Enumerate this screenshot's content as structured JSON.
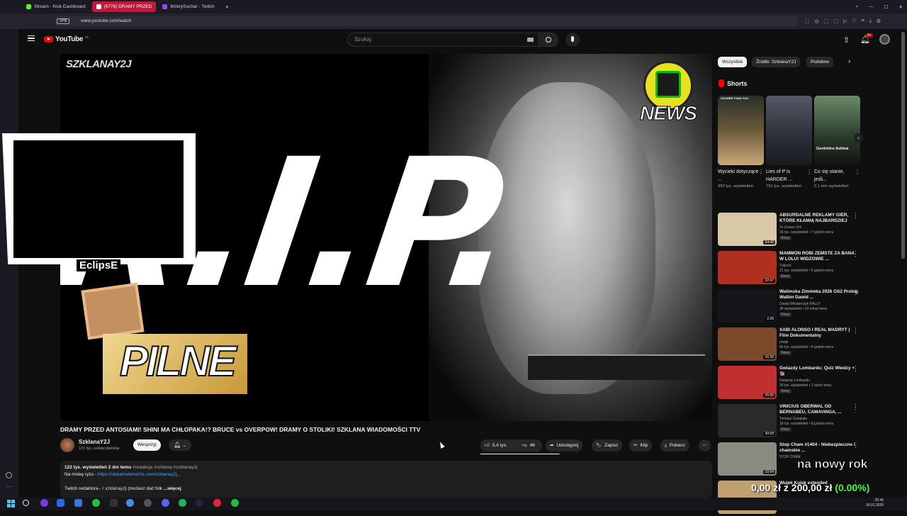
{
  "browser": {
    "tabs": [
      {
        "label": "Stream - Kick Dashboard",
        "color": "#53fc18"
      },
      {
        "label": "(6778) DRAMY PRZED",
        "color": "#ff0000"
      },
      {
        "label": "MokrySuchar - Twitch",
        "color": "#9146ff"
      }
    ],
    "url": "www.youtube.com/watch",
    "vpn_label": "VPN"
  },
  "header": {
    "logo_text": "YouTube",
    "logo_region": "PL",
    "search_placeholder": "Szukaj",
    "notifications_count": "9+"
  },
  "video": {
    "channel_watermark": "SZKLANAY2J",
    "news_badge": "NEWS",
    "big_text": "R.I.P.",
    "pilne_text": "PILNE",
    "overlay_name": "EclipsE",
    "title": "DRAMY PRZED ANTOSIAMI! SHINI MA CHŁOPAKA!? BRUCE vs OVERPOW! DRAMY O STOLIKI! SZKLANA WIADOMOŚCI TTV"
  },
  "channel": {
    "name": "SzklanaY2J",
    "subscribers": "121 tys. subskrybentów",
    "support_label": "Wesprzyj"
  },
  "actions": {
    "likes": "5,4 tys.",
    "dislikes": "46",
    "share": "Udostępnij",
    "save": "Zapisz",
    "clip": "Klip",
    "download": "Pobierz"
  },
  "description": {
    "stats": "122 tys. wyświetleń  2 dni temu",
    "tags": "#redakcja #szklana #szklanay2j",
    "line2_prefix": "Na miskę ryżu - ",
    "line2_link": "https://streamelements.com/szklanay2j...",
    "line3": "Twitch redaktora - ",
    "line3_handle": "/ szklanay2j",
    "line3_rest": "  (możesz dać folk",
    "more": "...więcej"
  },
  "chips": [
    "Wszystkie",
    "Źródło: SzklanaY2J",
    "Podobne"
  ],
  "shorts": {
    "heading": "Shorts",
    "items": [
      {
        "title": "Wycieki dotyczące ...",
        "views": "352 tys. wyświetleń",
        "thumb_color": "#6a5a3a",
        "overlay": "SOONER THAN YOU"
      },
      {
        "title": "Lies of P is HARDER ...",
        "views": "791 tys. wyświetleń",
        "thumb_color": "#3a3f4a",
        "overlay": ""
      },
      {
        "title": "Co się stanie, jeśli...",
        "views": "2,1 mln wyświetleń",
        "thumb_color": "#4a6a4a",
        "overlay": "Genichiro Ashina"
      }
    ]
  },
  "related": [
    {
      "title": "ABSURDALNE REKLAMY GIER, KTÓRE KŁAMIĄ NAJBARDZIEJ",
      "channel": "To Znowu Oni",
      "meta": "39 tys. wyświetleń • 7 godzin temu",
      "badge": "Nowy",
      "duration": "24:49",
      "thumb_color": "#d8c8a8"
    },
    {
      "title": "MAMMON ROBI ZEMSTE ZA BANA W LOLU! WIDZOWIE ...",
      "channel": "Tubson",
      "meta": "21 tys. wyświetleń • 5 godzin temu",
      "badge": "Nowy",
      "duration": "22:47",
      "thumb_color": "#b03020"
    },
    {
      "title": "Walimska Zimówka 2026 OS2 Prolog Wallim Dawid ...",
      "channel": "Dawid Włodarczyk RALLY",
      "meta": "38 wyświetleń • 14 minut temu",
      "badge": "Nowy",
      "duration": "2:39",
      "thumb_color": "#15151a"
    },
    {
      "title": "XABI ALONSO I REAL MADRYT | Film Dokumentalny",
      "channel": "rmejk",
      "meta": "66 tys. wyświetleń • 8 godzin temu",
      "badge": "Nowy",
      "duration": "16:36",
      "thumb_color": "#7a4a2a"
    },
    {
      "title": "Gwiazdy Lombardu: Quiz Wiedzy + 📚",
      "channel": "Gwiazdy Lombardu",
      "meta": "30 tys. wyświetleń • 1 dzień temu",
      "badge": "Nowy",
      "duration": "25:55",
      "thumb_color": "#c03030"
    },
    {
      "title": "VINICIUS OBERWAL OD BERNABEU, CAMAVINGA, ...",
      "channel": "Tomasz Ćwiąkała",
      "meta": "18 tys. wyświetleń • 8 godzin temu",
      "badge": "Nowy",
      "duration": "30:08",
      "thumb_color": "#2a2a2a"
    },
    {
      "title": "Stop Cham #1404 - Niebezpieczne i chamskie ...",
      "channel": "STOP CHAM",
      "meta": "",
      "badge": "",
      "duration": "10:04",
      "thumb_color": "#8a8a80"
    },
    {
      "title": "Wujek Kulak extended",
      "channel": "",
      "meta": "",
      "badge": "",
      "duration": "",
      "thumb_color": "#c0a070"
    }
  ],
  "overlay_donation": {
    "line1": "na nowy rok",
    "amount": "0,00 zł",
    "target": " z 200,00 zł",
    "percent": "(0.00%)"
  },
  "taskbar": {
    "time": "20:46",
    "date": "18.01.2026"
  },
  "colors": {
    "accent_red": "#ff0000",
    "pilne_gold": "#e8c060",
    "progress_green": "#3cff3c"
  }
}
